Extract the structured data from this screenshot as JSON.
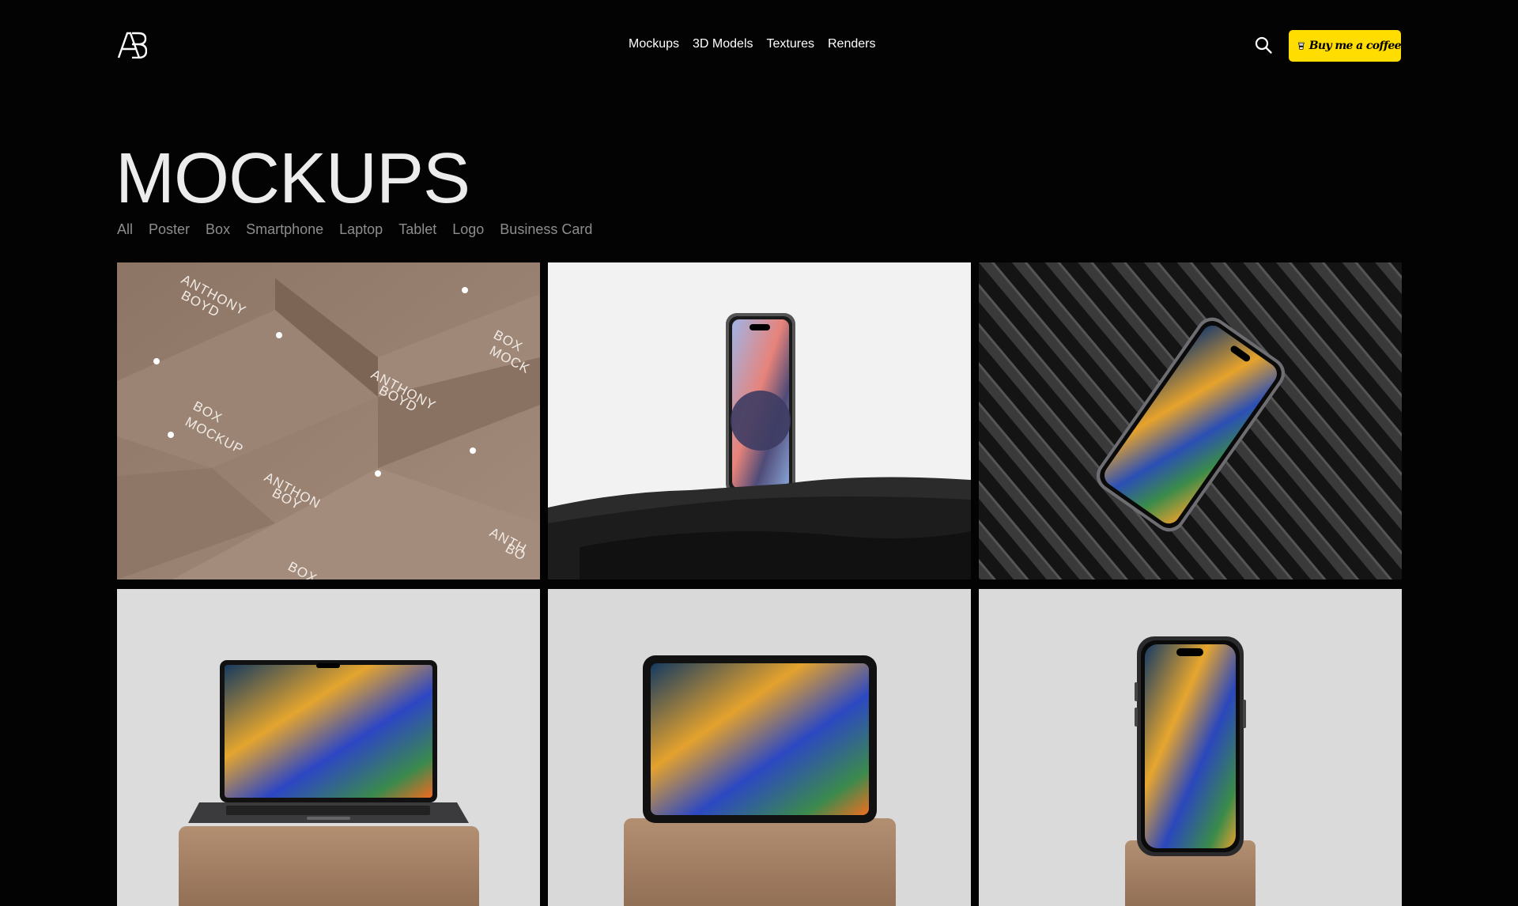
{
  "header": {
    "logo_alt": "AB",
    "nav": [
      "Mockups",
      "3D Models",
      "Textures",
      "Renders"
    ],
    "coffee_button": "Buy me a coffee",
    "colors": {
      "background": "#030303",
      "accent": "#ffdd00"
    }
  },
  "page": {
    "title": "MOCKUPS",
    "filters": [
      "All",
      "Poster",
      "Box",
      "Smartphone",
      "Laptop",
      "Tablet",
      "Logo",
      "Business Card"
    ]
  },
  "cards": [
    {
      "kind": "box-mockup",
      "texts": [
        "ANTHONY BOYD",
        "BOX MOCKUP"
      ]
    },
    {
      "kind": "smartphone-on-rock"
    },
    {
      "kind": "smartphone-on-stripes"
    },
    {
      "kind": "laptop-on-pedestal"
    },
    {
      "kind": "tablet-on-pedestal"
    },
    {
      "kind": "smartphone-on-pedestal"
    }
  ]
}
